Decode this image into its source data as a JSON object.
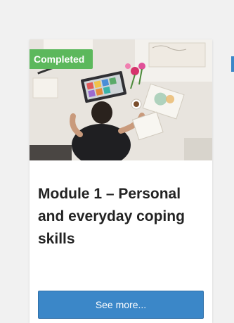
{
  "card": {
    "badge": "Completed",
    "title": "Module 1 – Personal and everyday coping skills",
    "button_label": "See more...",
    "image_description": "Person at a desk with a laptop and papers, viewed from above"
  },
  "colors": {
    "badge": "#5cb85c",
    "button": "#3b87c8",
    "title": "#222222",
    "background": "#f1f1f1"
  }
}
